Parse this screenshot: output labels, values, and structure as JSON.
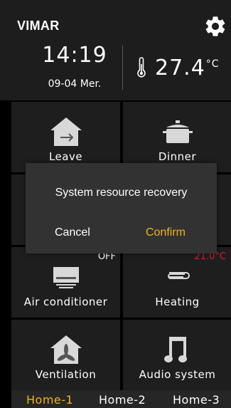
{
  "header": {
    "brand": "VIMAR",
    "time": "14:19",
    "date": "09-04  Mer.",
    "temperature": "27.4",
    "temperature_unit": "°C"
  },
  "tiles": [
    {
      "label": "Leave",
      "icon": "house-exit-icon"
    },
    {
      "label": "Dinner",
      "icon": "pot-icon"
    },
    {
      "label": "",
      "icon": ""
    },
    {
      "label": "",
      "icon": ""
    },
    {
      "label": "Air conditioner",
      "icon": "air-conditioner-icon",
      "state": "OFF"
    },
    {
      "label": "Heating",
      "icon": "radiator-icon",
      "state": "21.0°C"
    },
    {
      "label": "Ventilation",
      "icon": "house-fan-icon"
    },
    {
      "label": "Audio system",
      "icon": "music-note-icon"
    }
  ],
  "dialog": {
    "message": "System resource recovery",
    "cancel_label": "Cancel",
    "confirm_label": "Confirm"
  },
  "tabs": [
    {
      "label": "Home-1",
      "active": true
    },
    {
      "label": "Home-2",
      "active": false
    },
    {
      "label": "Home-3",
      "active": false
    }
  ],
  "colors": {
    "accent": "#f2b21e",
    "warm_state": "#d81f2a",
    "tile_bg": "#1e1e1e",
    "dialog_bg": "#323232"
  }
}
